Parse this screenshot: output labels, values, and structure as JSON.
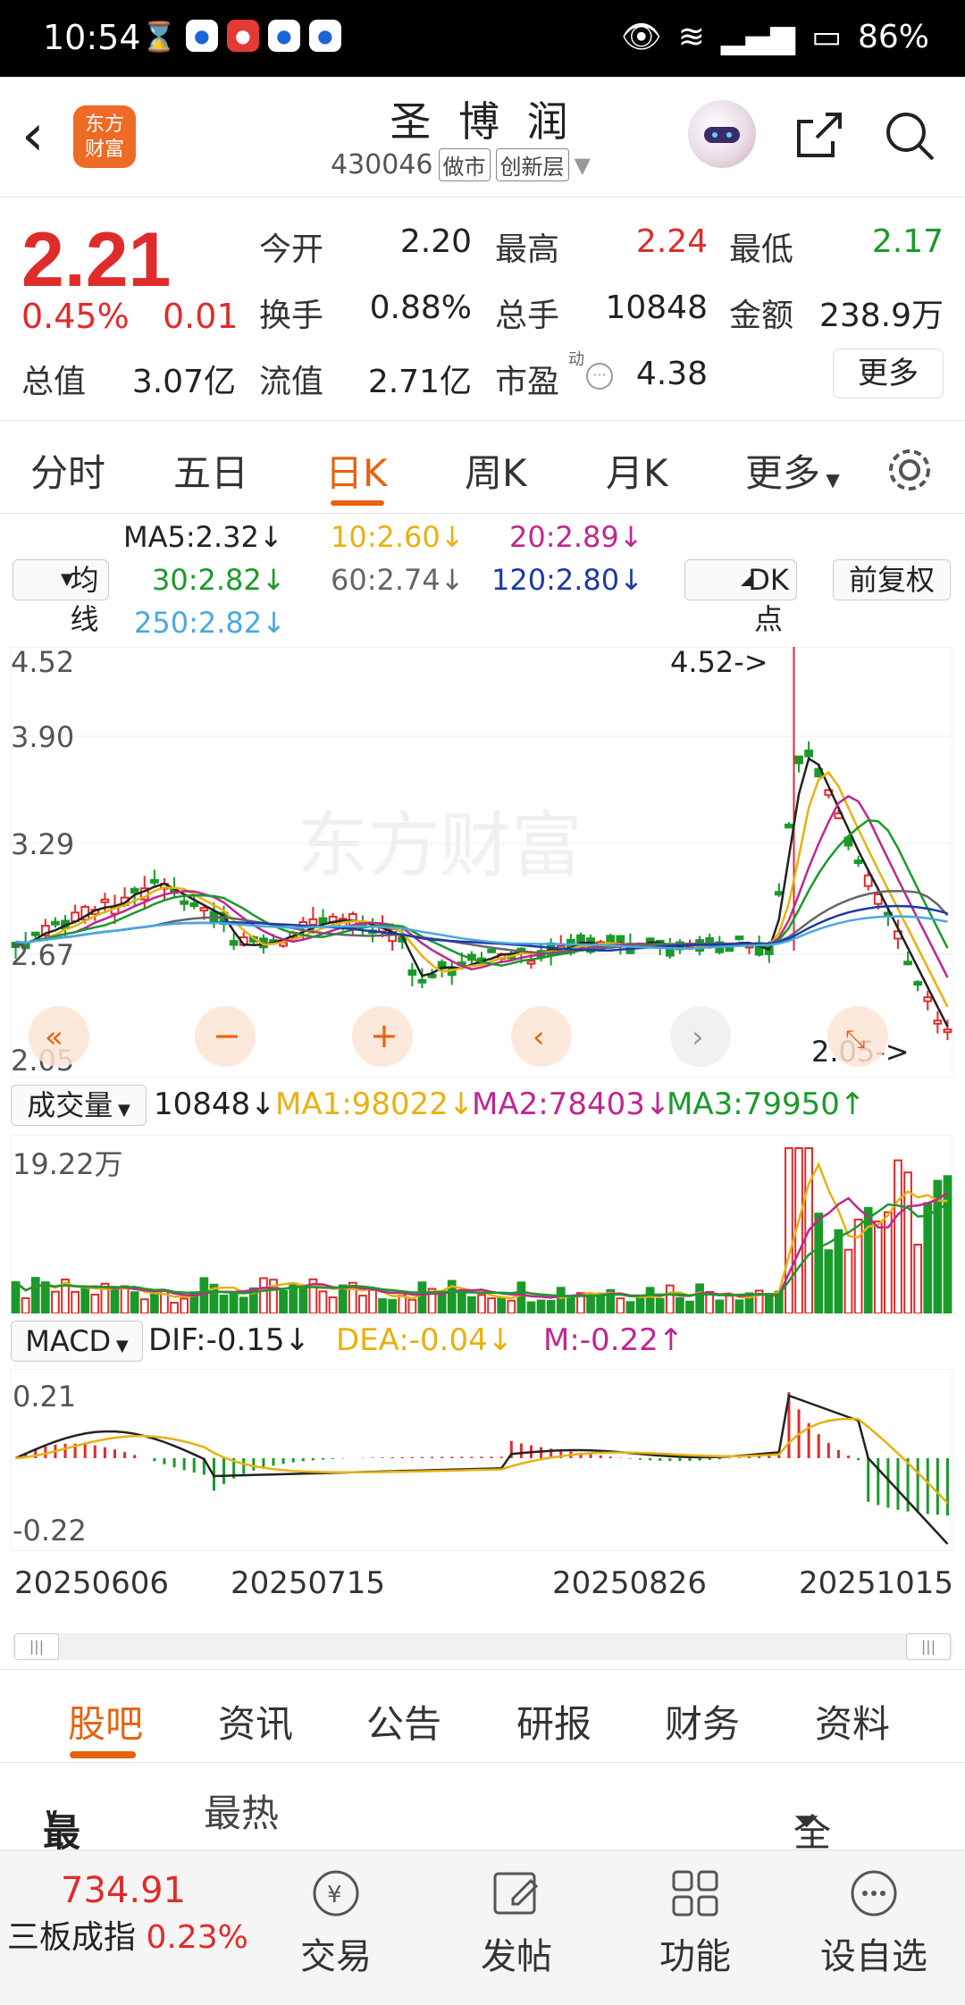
{
  "status_bar": {
    "time": "10:54",
    "battery": "86%"
  },
  "header": {
    "back": "‹",
    "logo_line1": "东方",
    "logo_line2": "财富",
    "stock_name": "圣 博 润",
    "code": "430046",
    "tag1": "做市",
    "tag2": "创新层"
  },
  "quote": {
    "price": "2.21",
    "pct": "0.45%",
    "change": "0.01",
    "open_label": "今开",
    "open": "2.20",
    "high_label": "最高",
    "high": "2.24",
    "low_label": "最低",
    "low": "2.17",
    "turnover_label": "换手",
    "turnover": "0.88%",
    "vol_label": "总手",
    "vol": "10848",
    "amount_label": "金额",
    "amount": "238.9万",
    "mcap_label": "总值",
    "mcap": "3.07亿",
    "float_label": "流值",
    "float": "2.71亿",
    "pe_label": "市盈",
    "pe_sup": "动",
    "pe": "4.38",
    "more": "更多"
  },
  "tabs": [
    "分时",
    "五日",
    "日K",
    "周K",
    "月K",
    "更多"
  ],
  "ma": {
    "selector": "均线",
    "ma5": "MA5:2.32↓",
    "ma10": "10:2.60↓",
    "ma20": "20:2.89↓",
    "ma30": "30:2.82↓",
    "ma60": "60:2.74↓",
    "ma120": "120:2.80↓",
    "ma250": "250:2.82↓",
    "dk": "DK点",
    "adjust": "前复权"
  },
  "main_chart": {
    "y_max": "4.52",
    "y2": "3.90",
    "y3": "3.29",
    "y4": "2.67",
    "y_min": "2.05",
    "high_marker": "4.52->",
    "low_marker": "2.05->",
    "watermark": "东方财富"
  },
  "volume": {
    "selector": "成交量",
    "vol": "10848↓",
    "ma1": "MA1:98022↓",
    "ma2": "MA2:78403↓",
    "ma3": "MA3:79950↑",
    "y_max": "19.22万"
  },
  "macd": {
    "selector": "MACD",
    "dif": "DIF:-0.15↓",
    "dea": "DEA:-0.04↓",
    "m": "M:-0.22↑",
    "y_max": "0.21",
    "y_min": "-0.22"
  },
  "dates": [
    "20250606",
    "20250715",
    "20250826",
    "20251015"
  ],
  "bottom_tabs": [
    "股吧",
    "资讯",
    "公告",
    "研报",
    "财务",
    "资料"
  ],
  "filter": {
    "latest": "最新",
    "hot": "最热",
    "all": "全部"
  },
  "footer": {
    "index_value": "734.91",
    "index_name": "三板成指",
    "index_pct": "0.23%",
    "trade": "交易",
    "post": "发帖",
    "func": "功能",
    "watch": "设自选"
  },
  "colors": {
    "up": "#e02b2b",
    "down": "#1a9a2a",
    "accent": "#e8620f"
  }
}
